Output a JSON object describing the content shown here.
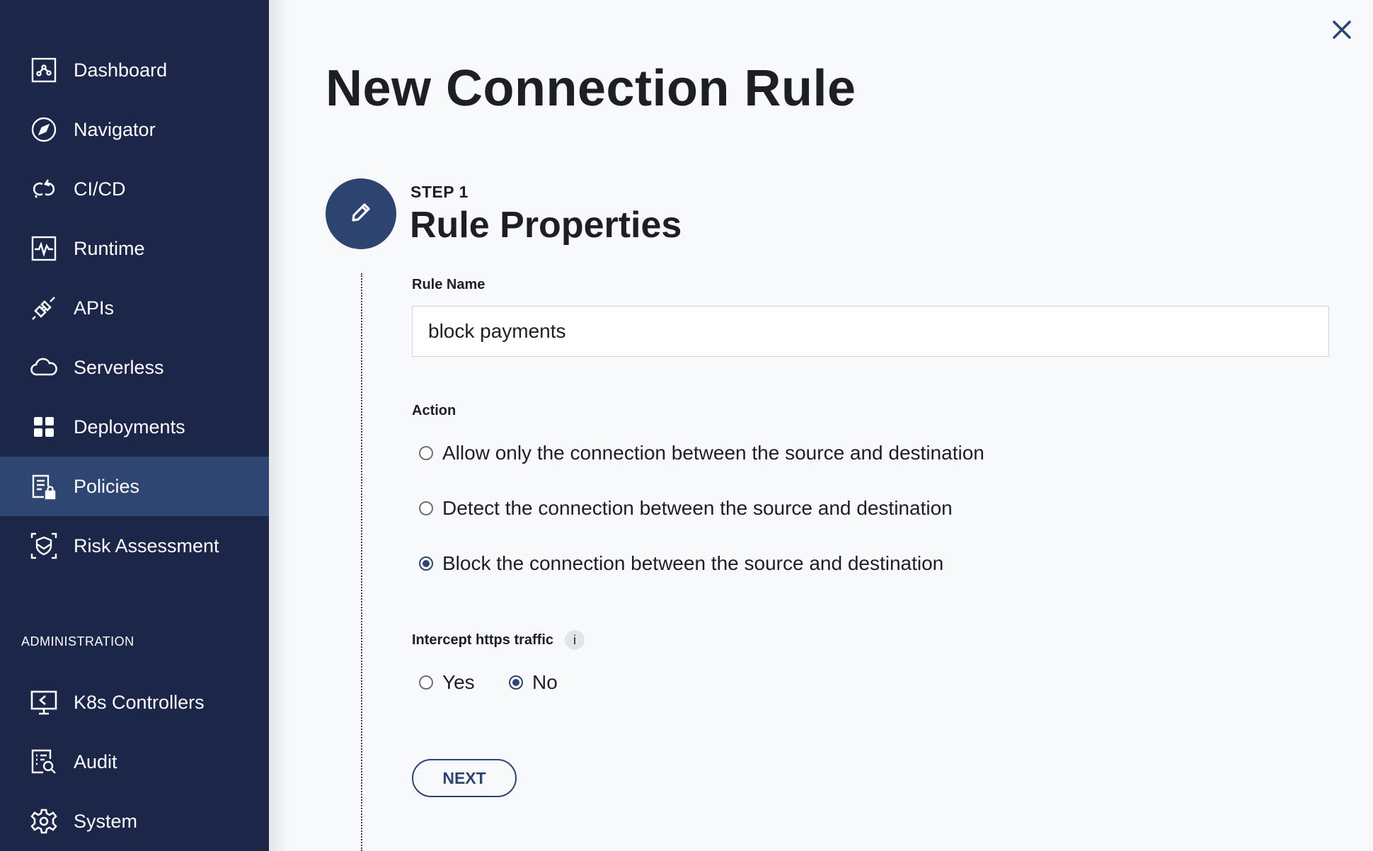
{
  "sidebar": {
    "items": [
      {
        "label": "Dashboard",
        "icon": "dashboard-icon"
      },
      {
        "label": "Navigator",
        "icon": "compass-icon"
      },
      {
        "label": "CI/CD",
        "icon": "cicd-icon"
      },
      {
        "label": "Runtime",
        "icon": "runtime-icon"
      },
      {
        "label": "APIs",
        "icon": "api-icon"
      },
      {
        "label": "Serverless",
        "icon": "cloud-icon"
      },
      {
        "label": "Deployments",
        "icon": "grid-icon"
      },
      {
        "label": "Policies",
        "icon": "policy-icon",
        "active": true
      },
      {
        "label": "Risk Assessment",
        "icon": "risk-shield-icon"
      }
    ],
    "admin_section_label": "ADMINISTRATION",
    "admin_items": [
      {
        "label": "K8s Controllers",
        "icon": "monitor-icon"
      },
      {
        "label": "Audit",
        "icon": "audit-icon"
      },
      {
        "label": "System",
        "icon": "gear-icon"
      }
    ]
  },
  "main": {
    "title": "New Connection Rule",
    "step": {
      "label": "STEP 1",
      "title": "Rule Properties"
    },
    "rule_name": {
      "label": "Rule Name",
      "value": "block payments"
    },
    "action": {
      "label": "Action",
      "options": [
        "Allow only the connection between the source and destination",
        "Detect the connection between the source and destination",
        "Block the connection between the source and destination"
      ],
      "selected_index": 2
    },
    "intercept": {
      "label": "Intercept https traffic",
      "info_glyph": "i",
      "options": [
        "Yes",
        "No"
      ],
      "selected": "No"
    },
    "next_label": "NEXT"
  },
  "colors": {
    "sidebar_bg": "#1b2649",
    "sidebar_active": "#2f4673",
    "accent": "#2d4470",
    "page_bg": "#f8f9fb"
  }
}
